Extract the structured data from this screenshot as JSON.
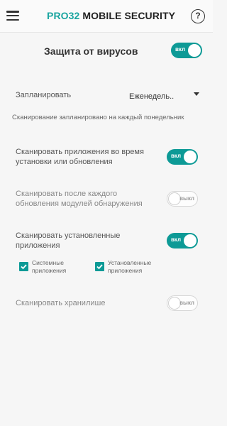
{
  "header": {
    "brand_part1": "PRO32",
    "brand_part2": " MOBILE SECURITY",
    "help_label": "?"
  },
  "main": {
    "title": "Защита от вирусов",
    "master_toggle": {
      "label": "вкл",
      "state": "on"
    }
  },
  "schedule": {
    "label": "Запланировать",
    "selected": "Еженедель..",
    "note": "Сканирование запланировано на каждый понедельник"
  },
  "settings": [
    {
      "label_line1": "Сканировать приложения во время",
      "label_line2": "установки или обновления",
      "toggle_label": "вкл",
      "state": "on"
    },
    {
      "label_line1": "Сканировать после каждого",
      "label_line2": "обновления модулей обнаружения",
      "toggle_label": "выкл",
      "state": "off"
    },
    {
      "label_line1": "Сканировать установленные",
      "label_line2": "приложения",
      "toggle_label": "вкл",
      "state": "on"
    },
    {
      "label_line1": "Сканировать хранилише",
      "label_line2": "",
      "toggle_label": "выкл",
      "state": "off"
    }
  ],
  "checkboxes": [
    {
      "line1": "Системные",
      "line2": "приложения",
      "checked": true
    },
    {
      "line1": "Установленные",
      "line2": "приложения",
      "checked": true
    }
  ],
  "colors": {
    "accent": "#0d9a96",
    "brand_teal": "#1aa5a0"
  }
}
